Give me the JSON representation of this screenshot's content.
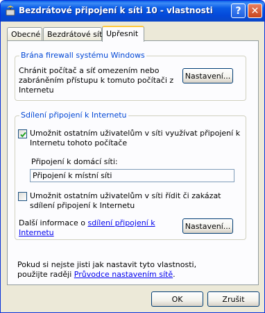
{
  "window": {
    "title": "Bezdrátové připojení k síti 10 - vlastnosti",
    "help_label": "?",
    "close_label": "✕"
  },
  "tabs": [
    {
      "label": "Obecné"
    },
    {
      "label": "Bezdrátové sítě"
    },
    {
      "label": "Upřesnit",
      "selected": true
    }
  ],
  "firewall": {
    "legend": "Brána firewall systému Windows",
    "description_line1": "Chránit počítač a síť omezením nebo",
    "description_line2": "zabráněním přístupu k tomuto počítači z",
    "description_line3": "Internetu",
    "settings_button": "Nastavení..."
  },
  "sharing": {
    "legend": "Sdílení připojení k Internetu",
    "allow_connect": {
      "checked": true,
      "line1": "Umožnit ostatním uživatelům v síti využívat připojení k",
      "line2": "Internetu tohoto počítače"
    },
    "home_network_label": "Připojení k domácí síti:",
    "home_network_value": "Připojení k místní síti",
    "allow_control": {
      "checked": false,
      "line1": "Umožnit ostatním uživatelům v síti řídit či zakázat",
      "line2": "sdílení připojení k Internetu"
    },
    "more_info_prefix": "Další informace o ",
    "more_info_link_1": "sdílení připojení k",
    "more_info_link_2": "Internetu",
    "settings_button": "Nastavení..."
  },
  "footer_note": {
    "line1": "Pokud si nejste jisti jak nastavit tyto vlastnosti,",
    "prefix": "použijte raději ",
    "link": "Průvodce nastavením sítě",
    "suffix": "."
  },
  "buttons": {
    "ok": "OK",
    "cancel": "Zrušit"
  },
  "colors": {
    "titlebar": "#0a5ce6",
    "face": "#ece9d8",
    "group_legend": "#0046d5",
    "link": "#0000ee",
    "active_tab_highlight": "#ffc83c"
  }
}
